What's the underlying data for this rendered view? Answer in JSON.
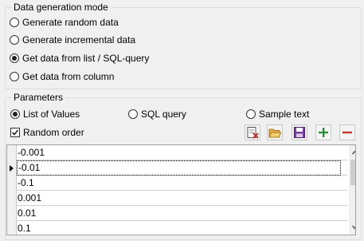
{
  "mode_group": {
    "title": "Data generation mode",
    "options": [
      {
        "label": "Generate random data",
        "selected": false
      },
      {
        "label": "Generate incremental data",
        "selected": false
      },
      {
        "label": "Get data from list / SQL-query",
        "selected": true
      },
      {
        "label": "Get data from column",
        "selected": false
      }
    ]
  },
  "params_group": {
    "title": "Parameters",
    "source_options": [
      {
        "label": "List of Values",
        "selected": true
      },
      {
        "label": "SQL query",
        "selected": false
      },
      {
        "label": "Sample text",
        "selected": false
      }
    ],
    "random_order": {
      "label": "Random order",
      "checked": true
    },
    "toolbar": [
      "clear-icon",
      "open-folder-icon",
      "save-icon",
      "add-icon",
      "remove-icon"
    ]
  },
  "values_grid": {
    "rows": [
      "-0.001",
      "-0.01",
      "-0.1",
      "0.001",
      "0.01",
      "0.1"
    ],
    "selected_index": 1
  },
  "colors": {
    "add": "#2e8b3a",
    "remove": "#c0392b",
    "folder": "#e8b34a",
    "save": "#7a3ea0"
  }
}
